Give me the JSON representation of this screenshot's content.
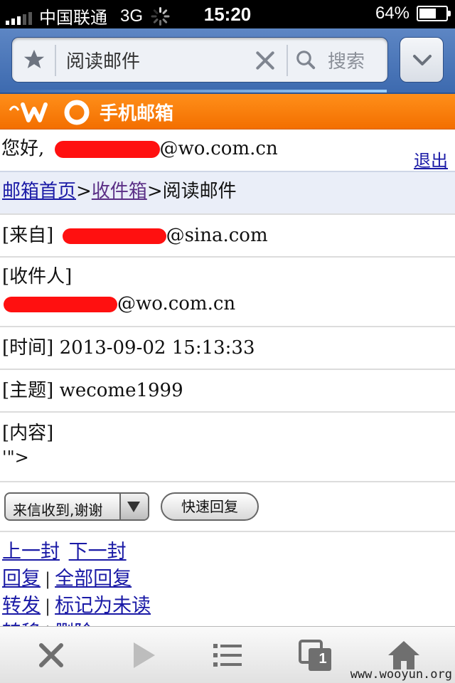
{
  "status_bar": {
    "carrier": "中国联通",
    "network": "3G",
    "time": "15:20",
    "battery": "64%",
    "battery_level": 0.64
  },
  "browser": {
    "url_title": "阅读邮件",
    "search_placeholder": "搜索"
  },
  "banner": {
    "brand": "手机邮箱"
  },
  "greeting": {
    "prefix": "您好,",
    "email_suffix": "@wo.com.cn",
    "logout": "退出"
  },
  "breadcrumb": {
    "home": "邮箱首页",
    "sep1": ">",
    "inbox": "收件箱",
    "sep2": ">",
    "current": "阅读邮件"
  },
  "mail": {
    "from_label": "[来自]",
    "from_suffix": "@sina.com",
    "to_label": "[收件人]",
    "to_suffix": "@wo.com.cn",
    "time_label": "[时间]",
    "time_value": "2013-09-02 15:13:33",
    "subject_label": "[主题]",
    "subject_value": "wecome1999",
    "content_label": "[内容]",
    "content_value": "'\">"
  },
  "reply": {
    "quick_reply_option": "来信收到,谢谢",
    "quick_reply_button": "快速回复"
  },
  "actions": {
    "prev": "上一封",
    "next": "下一封",
    "reply": "回复",
    "reply_all": "全部回复",
    "forward": "转发",
    "mark_unread": "标记为未读",
    "move": "转移",
    "delete": "删除",
    "separator": "|"
  },
  "bottom_toolbar": {
    "tabs_count": "1"
  },
  "watermark": "www.wooyun.org"
}
